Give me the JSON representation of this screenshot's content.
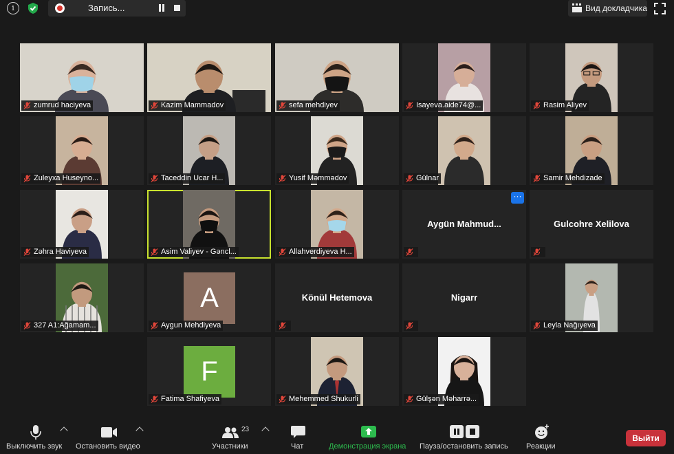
{
  "top_bar": {
    "recording_label": "Запись...",
    "speaker_view_label": "Вид докладчика"
  },
  "participants": [
    {
      "name": "zumrud haciyeva"
    },
    {
      "name": "Kazim Mammadov"
    },
    {
      "name": "sefa mehdiyev"
    },
    {
      "name": "Isayeva.aide74@..."
    },
    {
      "name": "Rasim Aliyev"
    },
    {
      "name": "Zuleyxa Huseyno..."
    },
    {
      "name": "Taceddin Ucar H..."
    },
    {
      "name": "Yusif Məmmədov"
    },
    {
      "name": "Gülnar"
    },
    {
      "name": "Samir Mehdizade"
    },
    {
      "name": "Zəhra Haviyeva"
    },
    {
      "name": "Asim Valiyev - Gəncl..."
    },
    {
      "name": "Allahverdiyeva H..."
    },
    {
      "name": "Aygün  Mahmud..."
    },
    {
      "name": "Gulcohre Xelilova"
    },
    {
      "name": "327 A1:Ağamam..."
    },
    {
      "name": "Aygun Mehdiyeva",
      "avatar_letter": "A"
    },
    {
      "name": "Könül Hetemova"
    },
    {
      "name": "Nigarr"
    },
    {
      "name": "Leyla Nağıyeva"
    },
    {
      "name": "Fatima Shafiyeva",
      "avatar_letter": "F"
    },
    {
      "name": "Mehemmed Shukurli"
    },
    {
      "name": "Gülşən Məharrə..."
    }
  ],
  "more_button_label": "···",
  "toolbar": {
    "mute_label": "Выключить звук",
    "video_label": "Остановить видео",
    "participants_label": "Участники",
    "participants_count": "23",
    "chat_label": "Чат",
    "share_label": "Демонстрация экрана",
    "record_label": "Пауза/остановить запись",
    "reactions_label": "Реакции",
    "leave_label": "Выйти"
  },
  "colors": {
    "share_accent": "#2dbb4e",
    "leave_button": "#c8323b",
    "active_speaker_border": "#c9e32e",
    "mute_icon": "#e0463a",
    "more_button": "#1a73e8"
  }
}
